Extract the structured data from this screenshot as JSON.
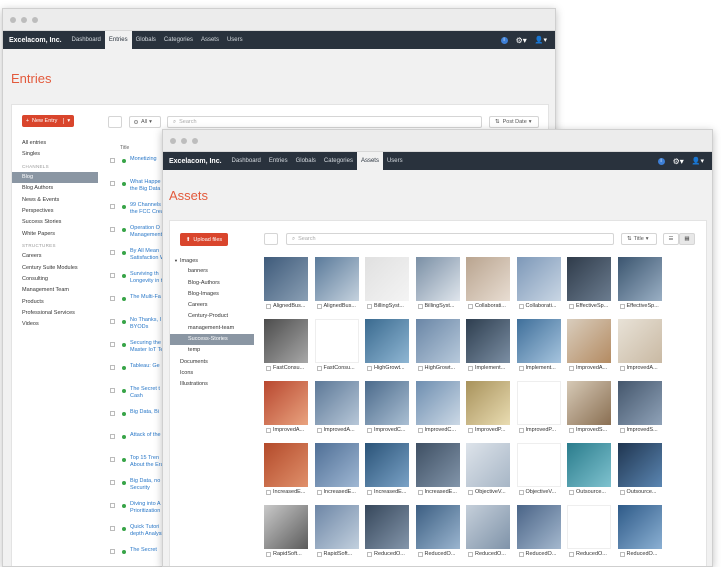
{
  "entries_window": {
    "brand": "Excelacom, Inc.",
    "nav": [
      "Dashboard",
      "Entries",
      "Globals",
      "Categories",
      "Assets",
      "Users"
    ],
    "page_title": "Entries",
    "new_entry_label": "New Entry",
    "all_label": "All",
    "search_placeholder": "Search",
    "sort_label": "Post Date",
    "title_header": "Title",
    "sidebar_top": [
      "All entries",
      "Singles"
    ],
    "channels_heading": "CHANNELS",
    "channels": [
      "Blog",
      "Blog Authors",
      "News & Events",
      "Perspectives",
      "Success Stories",
      "White Papers"
    ],
    "structures_heading": "STRUCTURES",
    "structures": [
      "Careers",
      "Century Suite Modules",
      "Consulting",
      "Management Team",
      "Products",
      "Professional Services",
      "Videos"
    ],
    "entries": [
      "Monetizing",
      "What Happe\nthe Big Data Ex",
      "99 Channels\nthe FCC Create",
      "Operation O\nManagement Tr",
      "By All Mean\nSatisfaction Wit",
      "Surviving th\nLongevity in the",
      "The Multi-Fa",
      "No Thanks, I\nBYODs",
      "Securing the\nMaster IoT Tech",
      "Tableau: Ge",
      "The Secret t\nCash",
      "Big Data, Bi",
      "Attack of the",
      "Top 15 Tren\nAbout the Era o",
      "Big Data, no\nSecurity",
      "Diving into A\nPrioritization",
      "Quick Tutori\ndepth Analysis",
      "The Secret"
    ]
  },
  "assets_window": {
    "brand": "Excelacom, Inc.",
    "nav": [
      "Dashboard",
      "Entries",
      "Globals",
      "Categories",
      "Assets",
      "Users"
    ],
    "page_title": "Assets",
    "upload_label": "Upload files",
    "search_placeholder": "Search",
    "sort_label": "Title",
    "tree": [
      "Images",
      "banners",
      "Blog-Authors",
      "Blog-Images",
      "Careers",
      "Century-Product",
      "management-team",
      "Success-Stories",
      "temp",
      "Documents",
      "Icons",
      "Illustrations"
    ],
    "thumbs": [
      "AlignedBus...",
      "AlignedBus...",
      "BillingSyst...",
      "BillingSyst...",
      "Collaborati...",
      "Collaborati...",
      "EffectiveSp...",
      "EffectiveSp...",
      "FastConsu...",
      "FastConsu...",
      "HighGrowt...",
      "HighGrowt...",
      "Implement...",
      "Implement...",
      "ImprovedA...",
      "ImprovedA...",
      "ImprovedA...",
      "ImprovedA...",
      "ImprovedC...",
      "ImprovedC...",
      "ImprovedP...",
      "ImprovedP...",
      "ImprovedS...",
      "ImprovedS...",
      "IncreasedE...",
      "IncreasedE...",
      "IncreasedE...",
      "IncreasedE...",
      "ObjectiveV...",
      "ObjectiveV...",
      "Outsource...",
      "Outsource...",
      "RapidSoft...",
      "RapidSoft...",
      "ReducedO...",
      "ReducedO...",
      "ReducedO...",
      "ReducedO...",
      "ReducedO...",
      "ReducedO..."
    ]
  },
  "colors": {
    "navbar": "#29323d",
    "accent_red": "#d9452c",
    "title_orange": "#e35a3c",
    "link_blue": "#2a78c8",
    "status_green": "#37a447",
    "selected_bg": "#8a96a3"
  }
}
